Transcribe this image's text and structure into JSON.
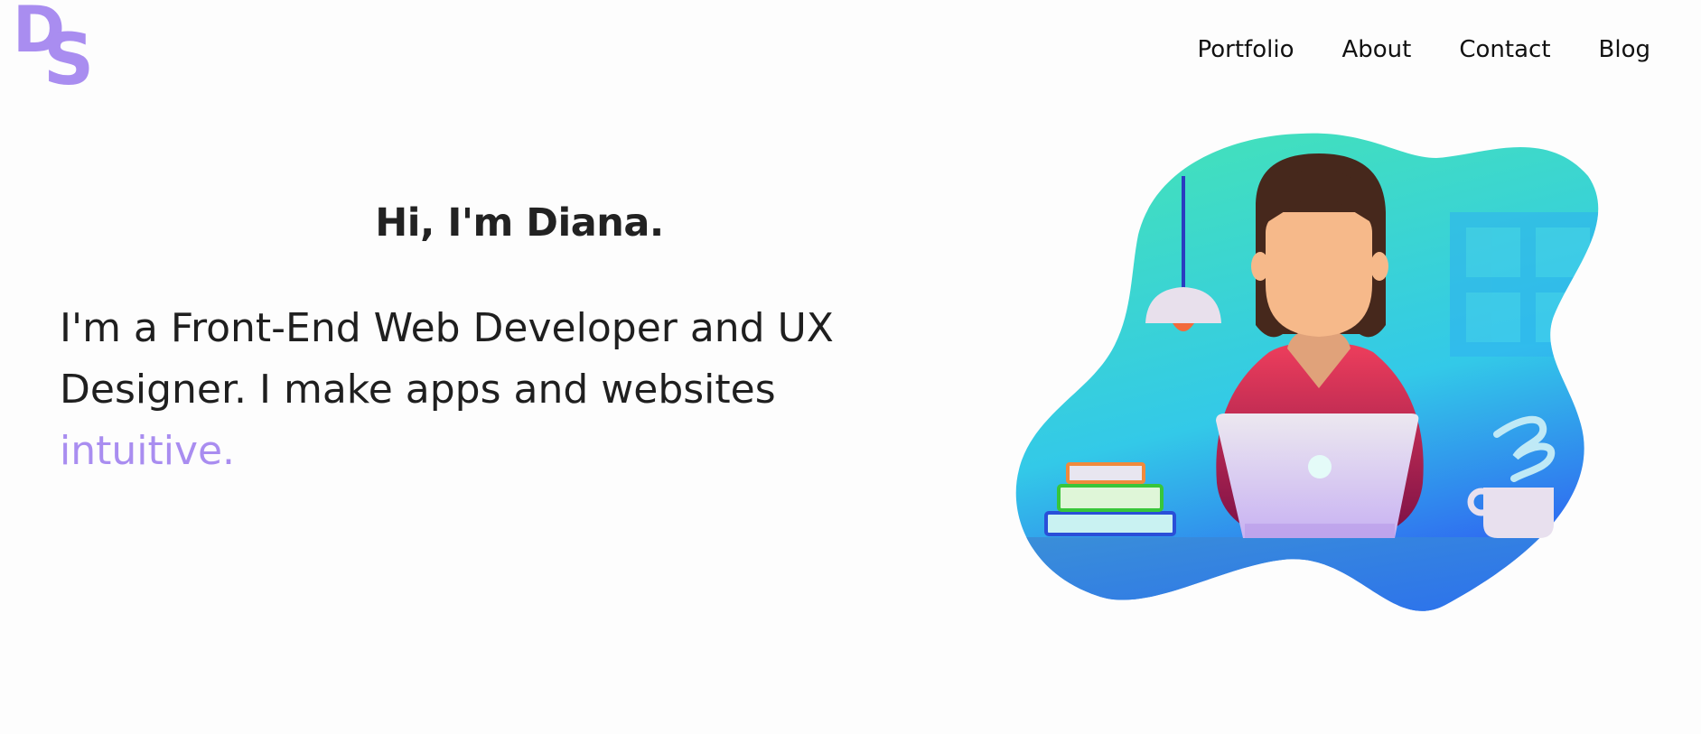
{
  "header": {
    "logo": {
      "letters": [
        "D",
        "S"
      ],
      "color": "#a98df0"
    },
    "nav": [
      {
        "label": "Portfolio"
      },
      {
        "label": "About"
      },
      {
        "label": "Contact"
      },
      {
        "label": "Blog"
      }
    ]
  },
  "hero": {
    "greeting": "Hi, I'm Diana.",
    "intro_lines": [
      "I'm a Front-End Web Developer and UX",
      "Designer. I make apps and websites"
    ],
    "intro_highlight": "intuitive.",
    "highlight_color": "#a98df0"
  },
  "illustration": {
    "icon": "developer-at-laptop-illustration",
    "colors": {
      "blob_top": "#45e4b5",
      "blob_bottom": "#2f6ff0",
      "shirt": "#e53a5c",
      "hair": "#46281c",
      "skin": "#f6b98a",
      "laptop": "#e6dcf5"
    }
  }
}
